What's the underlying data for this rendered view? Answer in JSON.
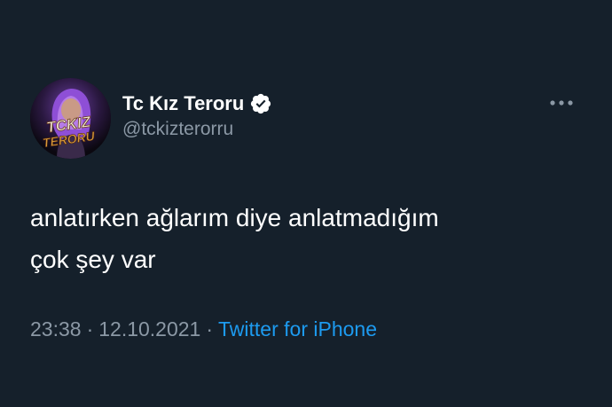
{
  "user": {
    "display_name": "Tc Kız Teroru",
    "handle": "@tckizterorru",
    "avatar_logo_text": [
      "TCKIZ",
      "TERORU"
    ],
    "verified": true
  },
  "tweet": {
    "text_line1": "anlatırken ağlarım diye anlatmadığım",
    "text_line2": "çok şey var"
  },
  "meta": {
    "time": "23:38",
    "date": "12.10.2021",
    "separator": "·",
    "source": "Twitter for iPhone"
  },
  "icons": {
    "more": "more-horizontal-icon",
    "verified": "verified-badge-icon"
  },
  "colors": {
    "background": "#15202b",
    "text": "#ffffff",
    "secondary": "#8b98a5",
    "link": "#1d9bf0"
  }
}
